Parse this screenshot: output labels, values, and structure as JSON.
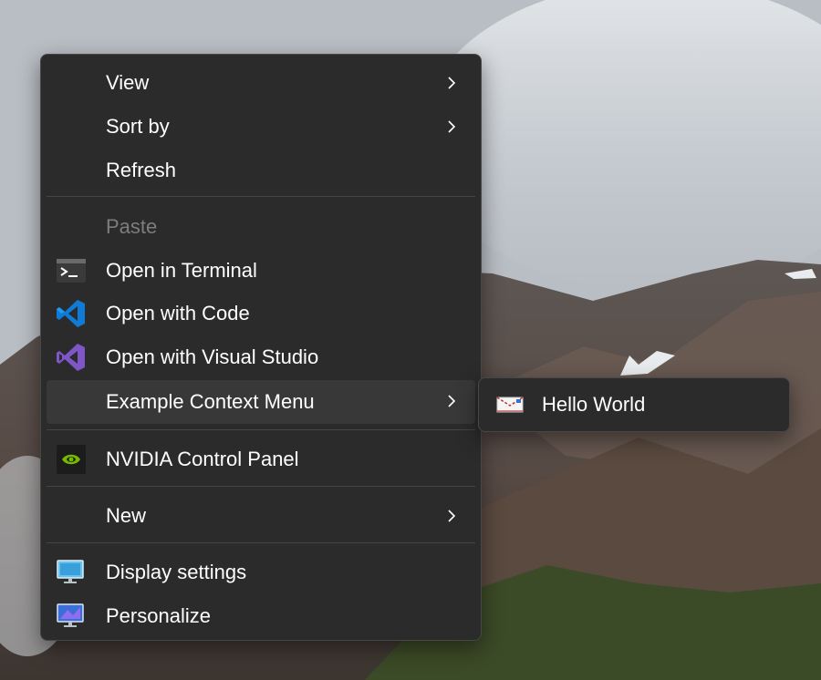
{
  "context_menu": {
    "items": [
      {
        "label": "View",
        "icon": "",
        "has_submenu": true
      },
      {
        "label": "Sort by",
        "icon": "",
        "has_submenu": true
      },
      {
        "label": "Refresh",
        "icon": "",
        "has_submenu": false
      },
      {
        "label": "Paste",
        "icon": "",
        "disabled": true
      },
      {
        "label": "Open in Terminal",
        "icon": "terminal-icon"
      },
      {
        "label": "Open with Code",
        "icon": "vscode-icon"
      },
      {
        "label": "Open with Visual Studio",
        "icon": "visual-studio-icon"
      },
      {
        "label": "Example Context Menu",
        "icon": "",
        "has_submenu": true,
        "highlighted": true
      },
      {
        "label": "NVIDIA Control Panel",
        "icon": "nvidia-icon"
      },
      {
        "label": "New",
        "icon": "",
        "has_submenu": true
      },
      {
        "label": "Display settings",
        "icon": "display-icon"
      },
      {
        "label": "Personalize",
        "icon": "personalize-icon"
      }
    ]
  },
  "submenu": {
    "items": [
      {
        "label": "Hello World",
        "icon": "envelope-icon"
      }
    ]
  },
  "colors": {
    "menu_bg": "#2b2b2b",
    "hover_bg": "#383838",
    "text": "#ffffff",
    "disabled_text": "#7d7d7d"
  }
}
